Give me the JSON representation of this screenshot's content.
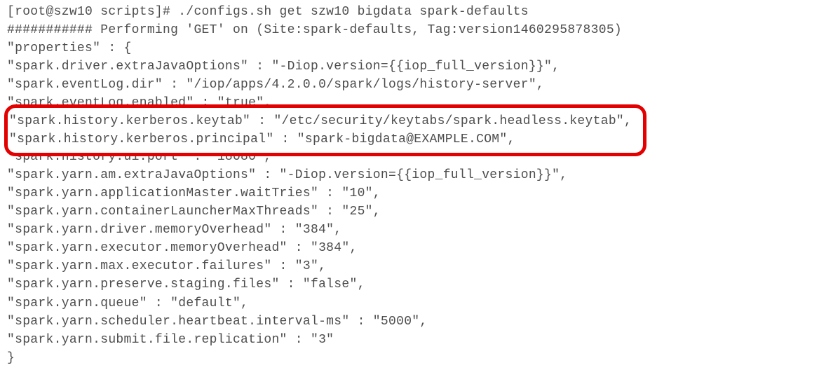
{
  "terminal": {
    "prompt_line": "[root@szw10 scripts]# ./configs.sh get szw10 bigdata spark-defaults",
    "status_line": "########### Performing 'GET' on (Site:spark-defaults, Tag:version1460295878305)",
    "properties_open": "\"properties\" : {",
    "props": {
      "driver_extraJava": "\"spark.driver.extraJavaOptions\" : \"-Diop.version={{iop_full_version}}\",",
      "eventLog_dir": "\"spark.eventLog.dir\" : \"/iop/apps/4.2.0.0/spark/logs/history-server\",",
      "eventLog_enabled": "\"spark.eventLog.enabled\" : \"true\",",
      "history_kerb_keytab": "\"spark.history.kerberos.keytab\" : \"/etc/security/keytabs/spark.headless.keytab\",",
      "history_kerb_principal": "\"spark.history.kerberos.principal\" : \"spark-bigdata@EXAMPLE.COM\",",
      "history_ui_port": "\"spark.history.ui.port\" : \"18080\",",
      "yarn_am_extraJava": "\"spark.yarn.am.extraJavaOptions\" : \"-Diop.version={{iop_full_version}}\",",
      "yarn_am_waitTries": "\"spark.yarn.applicationMaster.waitTries\" : \"10\",",
      "yarn_container_max": "\"spark.yarn.containerLauncherMaxThreads\" : \"25\",",
      "yarn_driver_memOv": "\"spark.yarn.driver.memoryOverhead\" : \"384\",",
      "yarn_exec_memOv": "\"spark.yarn.executor.memoryOverhead\" : \"384\",",
      "yarn_max_exec_fail": "\"spark.yarn.max.executor.failures\" : \"3\",",
      "yarn_preserve_staging": "\"spark.yarn.preserve.staging.files\" : \"false\",",
      "yarn_queue": "\"spark.yarn.queue\" : \"default\",",
      "yarn_sched_hb": "\"spark.yarn.scheduler.heartbeat.interval-ms\" : \"5000\",",
      "yarn_submit_repl": "\"spark.yarn.submit.file.replication\" : \"3\""
    },
    "properties_close": "}"
  }
}
